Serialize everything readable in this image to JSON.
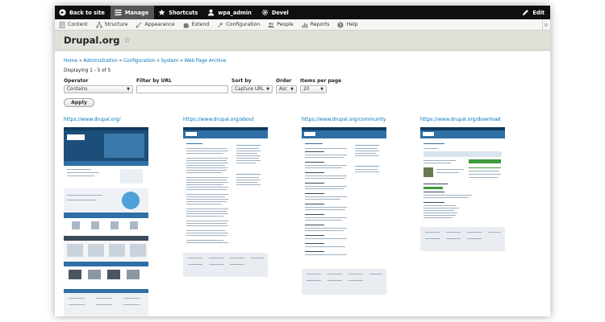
{
  "toolbar": {
    "back": "Back to site",
    "manage": "Manage",
    "shortcuts": "Shortcuts",
    "user": "wpa_admin",
    "devel": "Devel",
    "edit": "Edit"
  },
  "menu": {
    "items": [
      "Content",
      "Structure",
      "Appearance",
      "Extend",
      "Configuration",
      "People",
      "Reports",
      "Help"
    ]
  },
  "page": {
    "title": "Drupal.org"
  },
  "breadcrumb": [
    "Home",
    "Administration",
    "Configuration",
    "System",
    "Web Page Archive"
  ],
  "breadcrumb_sep": "»",
  "display_text": "Displaying 1 - 5 of 5",
  "filters": {
    "operator_label": "Operator",
    "operator_value": "Contains",
    "filter_label": "Filter by URL",
    "filter_value": "",
    "sort_label": "Sort by",
    "sort_value": "Capture URL",
    "order_label": "Order",
    "order_value": "Asc",
    "items_label": "Items per page",
    "items_value": "20",
    "apply": "Apply"
  },
  "captures": [
    {
      "url": "https://www.drupal.org/"
    },
    {
      "url": "https://www.drupal.org/about"
    },
    {
      "url": "https://www.drupal.org/community"
    },
    {
      "url": "https://www.drupal.org/download"
    }
  ],
  "colors": {
    "link": "#0074bd",
    "toolbar": "#0f0f0f",
    "header_bg": "#e0e0d8",
    "drupal_blue": "#2f6fa5"
  }
}
